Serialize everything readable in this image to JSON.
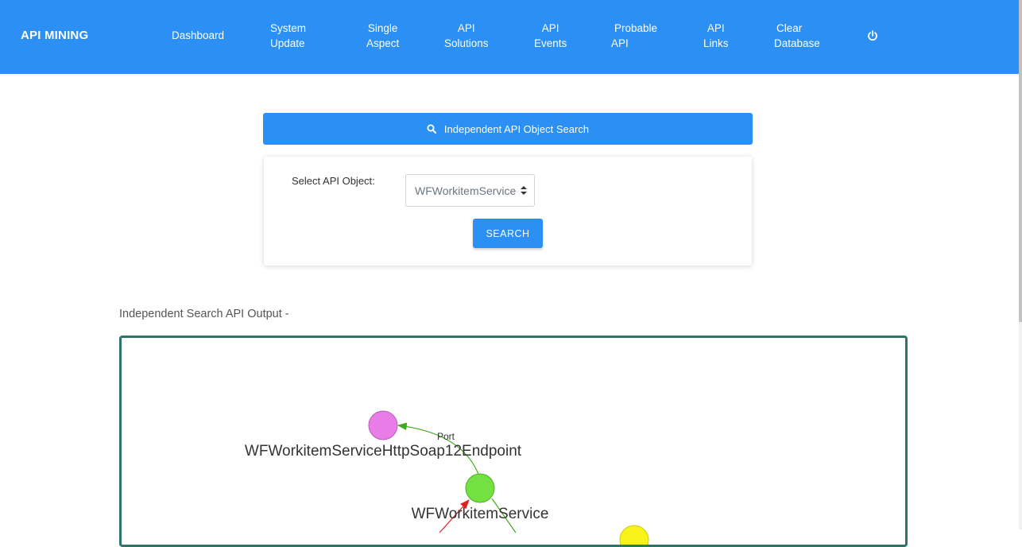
{
  "navbar": {
    "brand": "API MINING",
    "items": [
      {
        "line1": "Dashboard",
        "line2": ""
      },
      {
        "line1": "System",
        "line2": "Update"
      },
      {
        "line1": "Single",
        "line2": "Aspect"
      },
      {
        "line1": "API",
        "line2": "Solutions"
      },
      {
        "line1": "API",
        "line2": "Events"
      },
      {
        "line1": "Probable",
        "line2": "API"
      },
      {
        "line1": "API",
        "line2": "Links"
      },
      {
        "line1": "Clear",
        "line2": "Database"
      }
    ],
    "power_icon": "power-icon"
  },
  "search_panel": {
    "header": "Independent API Object Search",
    "header_icon": "search-icon",
    "label": "Select API Object:",
    "selected_value": "WFWorkitemService",
    "button_label": "SEARCH"
  },
  "output": {
    "title": "Independent Search API Output -",
    "graph": {
      "nodes": [
        {
          "id": "endpoint",
          "label": "WFWorkitemServiceHttpSoap12Endpoint",
          "color": "#e87de8"
        },
        {
          "id": "service",
          "label": "WFWorkitemService",
          "color": "#72e141"
        },
        {
          "id": "other",
          "label": "",
          "color": "#f7f21a"
        }
      ],
      "edges": [
        {
          "from": "service",
          "to": "endpoint",
          "label": "Port",
          "color": "#3faa1a"
        },
        {
          "from": "unknown",
          "to": "service",
          "label": "",
          "color": "#e02020"
        }
      ]
    }
  },
  "colors": {
    "primary": "#2b8ff3",
    "graph_border": "#2f7468"
  }
}
